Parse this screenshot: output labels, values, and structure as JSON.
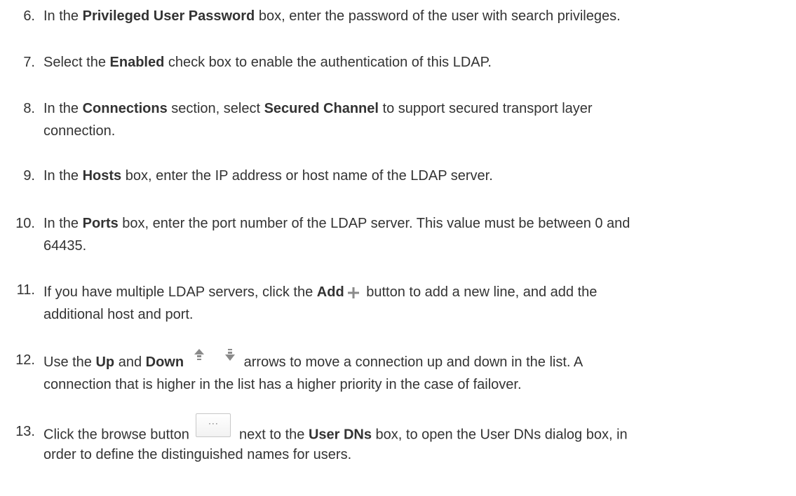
{
  "steps": [
    {
      "num": "6.",
      "p1": "In the ",
      "b1": "Privileged User Password",
      "p2": " box, enter the password of the user with search privileges."
    },
    {
      "num": "7.",
      "p1": "Select the ",
      "b1": "Enabled",
      "p2": " check box to enable the authentication of this LDAP."
    },
    {
      "num": "8.",
      "p1": "In the ",
      "b1": "Connections",
      "p2": " section, select ",
      "b2": "Secured Channel",
      "p3": " to support secured transport layer",
      "line2": "connection."
    },
    {
      "num": "9.",
      "p1": "In the ",
      "b1": "Hosts",
      "p2": " box, enter the IP address or host name of the LDAP server."
    },
    {
      "num": "10.",
      "p1": "In the ",
      "b1": "Ports",
      "p2": " box, enter the port number of the LDAP server. This value must be between 0 and",
      "line2": "64435."
    },
    {
      "num": "11.",
      "p1": "If you have multiple LDAP servers, click the ",
      "b1": "Add",
      "p2": " button to add a new line, and add the",
      "line2": "additional host and port."
    },
    {
      "num": "12.",
      "p1": "Use the ",
      "b1": "Up",
      "p2": " and ",
      "b2": "Down",
      "p3": " arrows to move a connection up and down in the list. A",
      "line2": "connection that is higher in the list has a higher priority in the case of failover."
    },
    {
      "num": "13.",
      "p1": "Click the browse button ",
      "browse_label": "···",
      "p2": " next to the ",
      "b1": "User DNs",
      "p3": " box, to open the User DNs dialog box, in",
      "line2": "order to define the distinguished names for users."
    }
  ],
  "icons": {
    "add": "plus-icon",
    "up": "arrow-up-icon",
    "down": "arrow-down-icon"
  },
  "colors": {
    "text": "#333333",
    "icon": "#8a8a8a"
  }
}
